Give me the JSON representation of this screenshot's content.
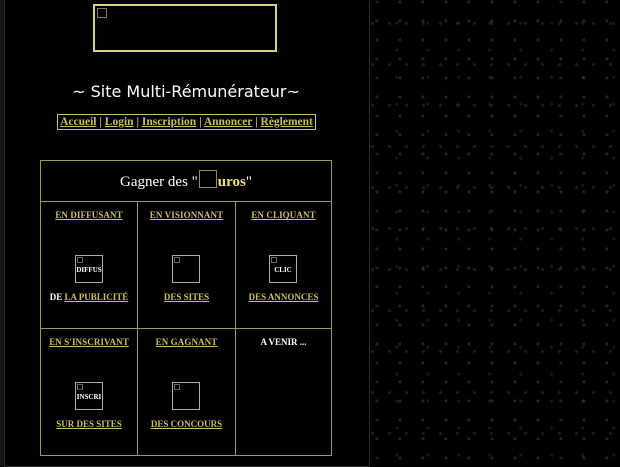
{
  "site": {
    "title": "~ Site Multi-Rémunérateur~"
  },
  "nav": {
    "items": [
      "Accueil",
      "Login",
      "Inscription",
      "Annoncer",
      "Règlement"
    ],
    "separator": "|"
  },
  "panel": {
    "heading_prefix": "Gagner des \"",
    "heading_word": "uros",
    "heading_suffix": "\"",
    "cells": [
      {
        "caption": "EN DIFFUSANT",
        "img_alt": "DIFFUS",
        "sub_prefix": "DE",
        "sub_link": "LA PUBLICITÉ"
      },
      {
        "caption": "EN VISIONNANT",
        "img_alt": "",
        "sub_prefix": "",
        "sub_link": "DES SITES"
      },
      {
        "caption": "EN CLIQUANT",
        "img_alt": "CLIC",
        "sub_prefix": "",
        "sub_link": "DES ANNONCES"
      },
      {
        "caption": "EN S'INSCRIVANT",
        "img_alt": "INSCRI",
        "sub_prefix": "",
        "sub_link": "SUR DES SITES"
      },
      {
        "caption": "EN GAGNANT",
        "img_alt": "",
        "sub_prefix": "",
        "sub_link": "DES CONCOURS"
      },
      {
        "caption": "",
        "img_alt": "",
        "sub_prefix": "",
        "sub_link": "",
        "static_text": "A VENIR ..."
      }
    ]
  },
  "colors": {
    "background": "#000000",
    "link": "#c9bf63",
    "border": "#9c9a5c",
    "euro_text": "#f3e17a",
    "banner_border": "#d7d08a"
  }
}
